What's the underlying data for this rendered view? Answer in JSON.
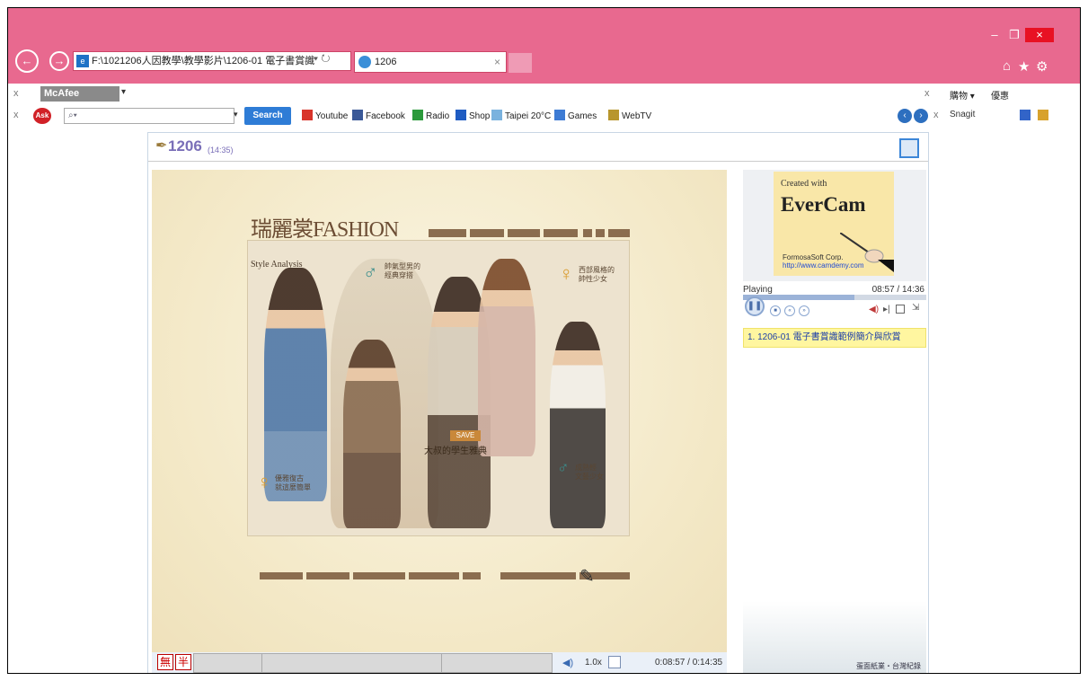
{
  "browser": {
    "address": "F:\\1021206人因教學\\教學影片\\1206-01 電子書賞識",
    "address_search_glyph": "⌕ ▾ ↻",
    "tab_title": "1206",
    "tab_close": "×",
    "window_min": "–",
    "window_max": "❐",
    "window_close": "×",
    "back_glyph": "←",
    "fwd_glyph": "→",
    "home_icon": "⌂",
    "star_icon": "★",
    "gear_icon": "⚙"
  },
  "toolbar1": {
    "close_x": "x",
    "mcafee_label": "McAfee",
    "mcafee_dd": "▾",
    "right_x": "x",
    "shopping_label": "購物",
    "shopping_dd": "▾",
    "coupon_label": "優惠"
  },
  "toolbar2": {
    "close_x": "x",
    "ask_logo": "Ask",
    "ask_dd": "▾",
    "search_label": "Search",
    "shortcuts": [
      "Youtube",
      "Facebook",
      "Radio",
      "Shop",
      "Taipei 20°C",
      "Games",
      "WebTV"
    ],
    "shortcut_colors": [
      "#d8342a",
      "#3b5998",
      "#2c9a3c",
      "#1f5cc2",
      "#7ab2de",
      "#3d7bd4",
      "#b8962d"
    ],
    "right_x": "x",
    "snagit_label": "Snagit"
  },
  "player": {
    "title": "1206",
    "duration": "(14:35)",
    "slide": {
      "fashion_title": "瑞麗裳FASHION",
      "style_analysis": "Style Analysis",
      "caption_1": "帥氣型男的\n經典穿搭",
      "caption_2": "西部風格的\n帥性少女",
      "caption_3": "優雅復古\n就這麼簡單",
      "caption_4": "成熟輕\n文藝少女",
      "save_badge": "SAVE",
      "save_heading": "大叔的學生雅典"
    },
    "control_bar": {
      "ime_a": "無",
      "ime_b": "半",
      "volume_glyph": "◀)",
      "speed": "1.0x",
      "time": "0:08:57 / 0:14:35"
    },
    "side": {
      "ec_created": "Created with",
      "ec_name": "EverCam",
      "ec_corp": "FormosaSoft Corp.",
      "ec_url": "http://www.camdemy.com",
      "status": "Playing",
      "time": "08:57 / 14:36",
      "progress": 0.61,
      "chapter": "1. 1206-01 電子書賞識範例簡介與欣賞",
      "scenery_caption": "蛋面紙業・台灣紀錄"
    }
  }
}
